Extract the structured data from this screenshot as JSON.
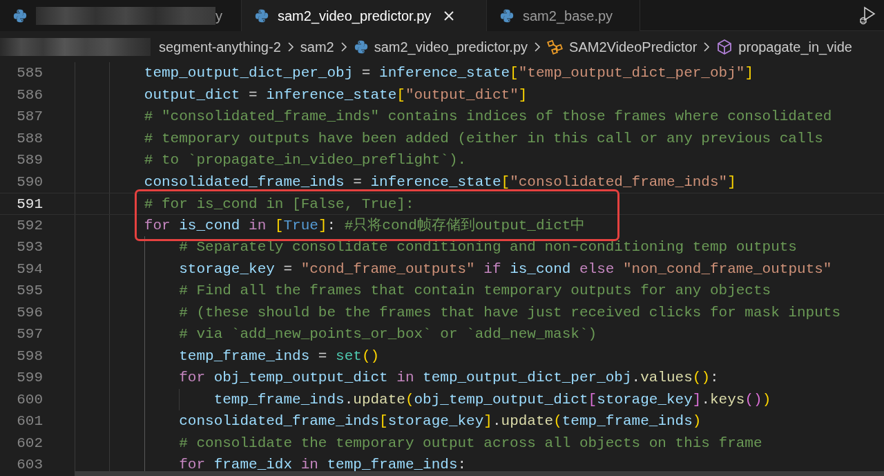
{
  "tabs": [
    {
      "label": "y",
      "selected": false,
      "redacted": true
    },
    {
      "label": "sam2_video_predictor.py",
      "selected": true,
      "redacted": false
    },
    {
      "label": "sam2_base.py",
      "selected": false,
      "redacted": false
    }
  ],
  "breadcrumbs": [
    {
      "kind": "redacted"
    },
    {
      "kind": "folder",
      "label": "segment-anything-2"
    },
    {
      "kind": "folder",
      "label": "sam2"
    },
    {
      "kind": "file",
      "label": "sam2_video_predictor.py"
    },
    {
      "kind": "class",
      "label": "SAM2VideoPredictor"
    },
    {
      "kind": "method",
      "label": "propagate_in_vide"
    }
  ],
  "lines": [
    {
      "number": "585",
      "active": false,
      "boxed": false,
      "tokens": [
        {
          "kind": "var",
          "text": "        temp_output_dict_per_obj"
        },
        {
          "kind": "op",
          "text": " = "
        },
        {
          "kind": "var",
          "text": "inference_state"
        },
        {
          "kind": "b1",
          "text": "["
        },
        {
          "kind": "str",
          "text": "\"temp_output_dict_per_obj\""
        },
        {
          "kind": "b1",
          "text": "]"
        }
      ]
    },
    {
      "number": "586",
      "active": false,
      "boxed": false,
      "tokens": [
        {
          "kind": "var",
          "text": "        output_dict"
        },
        {
          "kind": "op",
          "text": " = "
        },
        {
          "kind": "var",
          "text": "inference_state"
        },
        {
          "kind": "b1",
          "text": "["
        },
        {
          "kind": "str",
          "text": "\"output_dict\""
        },
        {
          "kind": "b1",
          "text": "]"
        }
      ]
    },
    {
      "number": "587",
      "active": false,
      "boxed": false,
      "tokens": [
        {
          "kind": "cmt",
          "text": "        # \"consolidated_frame_inds\" contains indices of those frames where consolidated"
        }
      ]
    },
    {
      "number": "588",
      "active": false,
      "boxed": false,
      "tokens": [
        {
          "kind": "cmt",
          "text": "        # temporary outputs have been added (either in this call or any previous calls"
        }
      ]
    },
    {
      "number": "589",
      "active": false,
      "boxed": false,
      "tokens": [
        {
          "kind": "cmt",
          "text": "        # to `propagate_in_video_preflight`)."
        }
      ]
    },
    {
      "number": "590",
      "active": false,
      "boxed": false,
      "tokens": [
        {
          "kind": "var",
          "text": "        consolidated_frame_inds"
        },
        {
          "kind": "op",
          "text": " = "
        },
        {
          "kind": "var",
          "text": "inference_state"
        },
        {
          "kind": "b1",
          "text": "["
        },
        {
          "kind": "str",
          "text": "\"consolidated_frame_inds\""
        },
        {
          "kind": "b1",
          "text": "]"
        }
      ]
    },
    {
      "number": "591",
      "active": true,
      "boxed": true,
      "tokens": [
        {
          "kind": "cmt",
          "text": "        # for is_cond in [False, True]:"
        }
      ]
    },
    {
      "number": "592",
      "active": false,
      "boxed": true,
      "tokens": [
        {
          "kind": "kw",
          "text": "        for"
        },
        {
          "kind": "var",
          "text": " is_cond "
        },
        {
          "kind": "kw",
          "text": "in "
        },
        {
          "kind": "b1",
          "text": "["
        },
        {
          "kind": "const",
          "text": "True"
        },
        {
          "kind": "b1",
          "text": "]"
        },
        {
          "kind": "op",
          "text": ": "
        },
        {
          "kind": "cmt",
          "text": "#只将cond帧存储到output_dict中"
        }
      ]
    },
    {
      "number": "593",
      "active": false,
      "boxed": false,
      "tokens": [
        {
          "kind": "cmt",
          "text": "            # Separately consolidate conditioning and non-conditioning temp outputs"
        }
      ]
    },
    {
      "number": "594",
      "active": false,
      "boxed": false,
      "tokens": [
        {
          "kind": "var",
          "text": "            storage_key"
        },
        {
          "kind": "op",
          "text": " = "
        },
        {
          "kind": "str",
          "text": "\"cond_frame_outputs\" "
        },
        {
          "kind": "kw",
          "text": "if"
        },
        {
          "kind": "var",
          "text": " is_cond "
        },
        {
          "kind": "kw",
          "text": "else "
        },
        {
          "kind": "str",
          "text": "\"non_cond_frame_outputs\""
        }
      ]
    },
    {
      "number": "595",
      "active": false,
      "boxed": false,
      "tokens": [
        {
          "kind": "cmt",
          "text": "            # Find all the frames that contain temporary outputs for any objects"
        }
      ]
    },
    {
      "number": "596",
      "active": false,
      "boxed": false,
      "tokens": [
        {
          "kind": "cmt",
          "text": "            # (these should be the frames that have just received clicks for mask inputs"
        }
      ]
    },
    {
      "number": "597",
      "active": false,
      "boxed": false,
      "tokens": [
        {
          "kind": "cmt",
          "text": "            # via `add_new_points_or_box` or `add_new_mask`)"
        }
      ]
    },
    {
      "number": "598",
      "active": false,
      "boxed": false,
      "tokens": [
        {
          "kind": "var",
          "text": "            temp_frame_inds"
        },
        {
          "kind": "op",
          "text": " = "
        },
        {
          "kind": "cls",
          "text": "set"
        },
        {
          "kind": "b1",
          "text": "()"
        }
      ]
    },
    {
      "number": "599",
      "active": false,
      "boxed": false,
      "tokens": [
        {
          "kind": "kw",
          "text": "            for"
        },
        {
          "kind": "var",
          "text": " obj_temp_output_dict "
        },
        {
          "kind": "kw",
          "text": "in"
        },
        {
          "kind": "var",
          "text": " temp_output_dict_per_obj"
        },
        {
          "kind": "op",
          "text": "."
        },
        {
          "kind": "fn",
          "text": "values"
        },
        {
          "kind": "b1",
          "text": "()"
        },
        {
          "kind": "op",
          "text": ":"
        }
      ]
    },
    {
      "number": "600",
      "active": false,
      "boxed": false,
      "tokens": [
        {
          "kind": "var",
          "text": "                temp_frame_inds"
        },
        {
          "kind": "op",
          "text": "."
        },
        {
          "kind": "fn",
          "text": "update"
        },
        {
          "kind": "b1",
          "text": "("
        },
        {
          "kind": "var",
          "text": "obj_temp_output_dict"
        },
        {
          "kind": "b2",
          "text": "["
        },
        {
          "kind": "var",
          "text": "storage_key"
        },
        {
          "kind": "b2",
          "text": "]"
        },
        {
          "kind": "op",
          "text": "."
        },
        {
          "kind": "fn",
          "text": "keys"
        },
        {
          "kind": "b2",
          "text": "()"
        },
        {
          "kind": "b1",
          "text": ")"
        }
      ]
    },
    {
      "number": "601",
      "active": false,
      "boxed": false,
      "tokens": [
        {
          "kind": "var",
          "text": "            consolidated_frame_inds"
        },
        {
          "kind": "b1",
          "text": "["
        },
        {
          "kind": "var",
          "text": "storage_key"
        },
        {
          "kind": "b1",
          "text": "]"
        },
        {
          "kind": "op",
          "text": "."
        },
        {
          "kind": "fn",
          "text": "update"
        },
        {
          "kind": "b1",
          "text": "("
        },
        {
          "kind": "var",
          "text": "temp_frame_inds"
        },
        {
          "kind": "b1",
          "text": ")"
        }
      ]
    },
    {
      "number": "602",
      "active": false,
      "boxed": false,
      "tokens": [
        {
          "kind": "cmt",
          "text": "            # consolidate the temporary output across all objects on this frame"
        }
      ]
    },
    {
      "number": "603",
      "active": false,
      "boxed": false,
      "tokens": [
        {
          "kind": "kw",
          "text": "            for"
        },
        {
          "kind": "var",
          "text": " frame_idx "
        },
        {
          "kind": "kw",
          "text": "in"
        },
        {
          "kind": "var",
          "text": " temp_frame_inds"
        },
        {
          "kind": "op",
          "text": ":"
        }
      ]
    }
  ]
}
